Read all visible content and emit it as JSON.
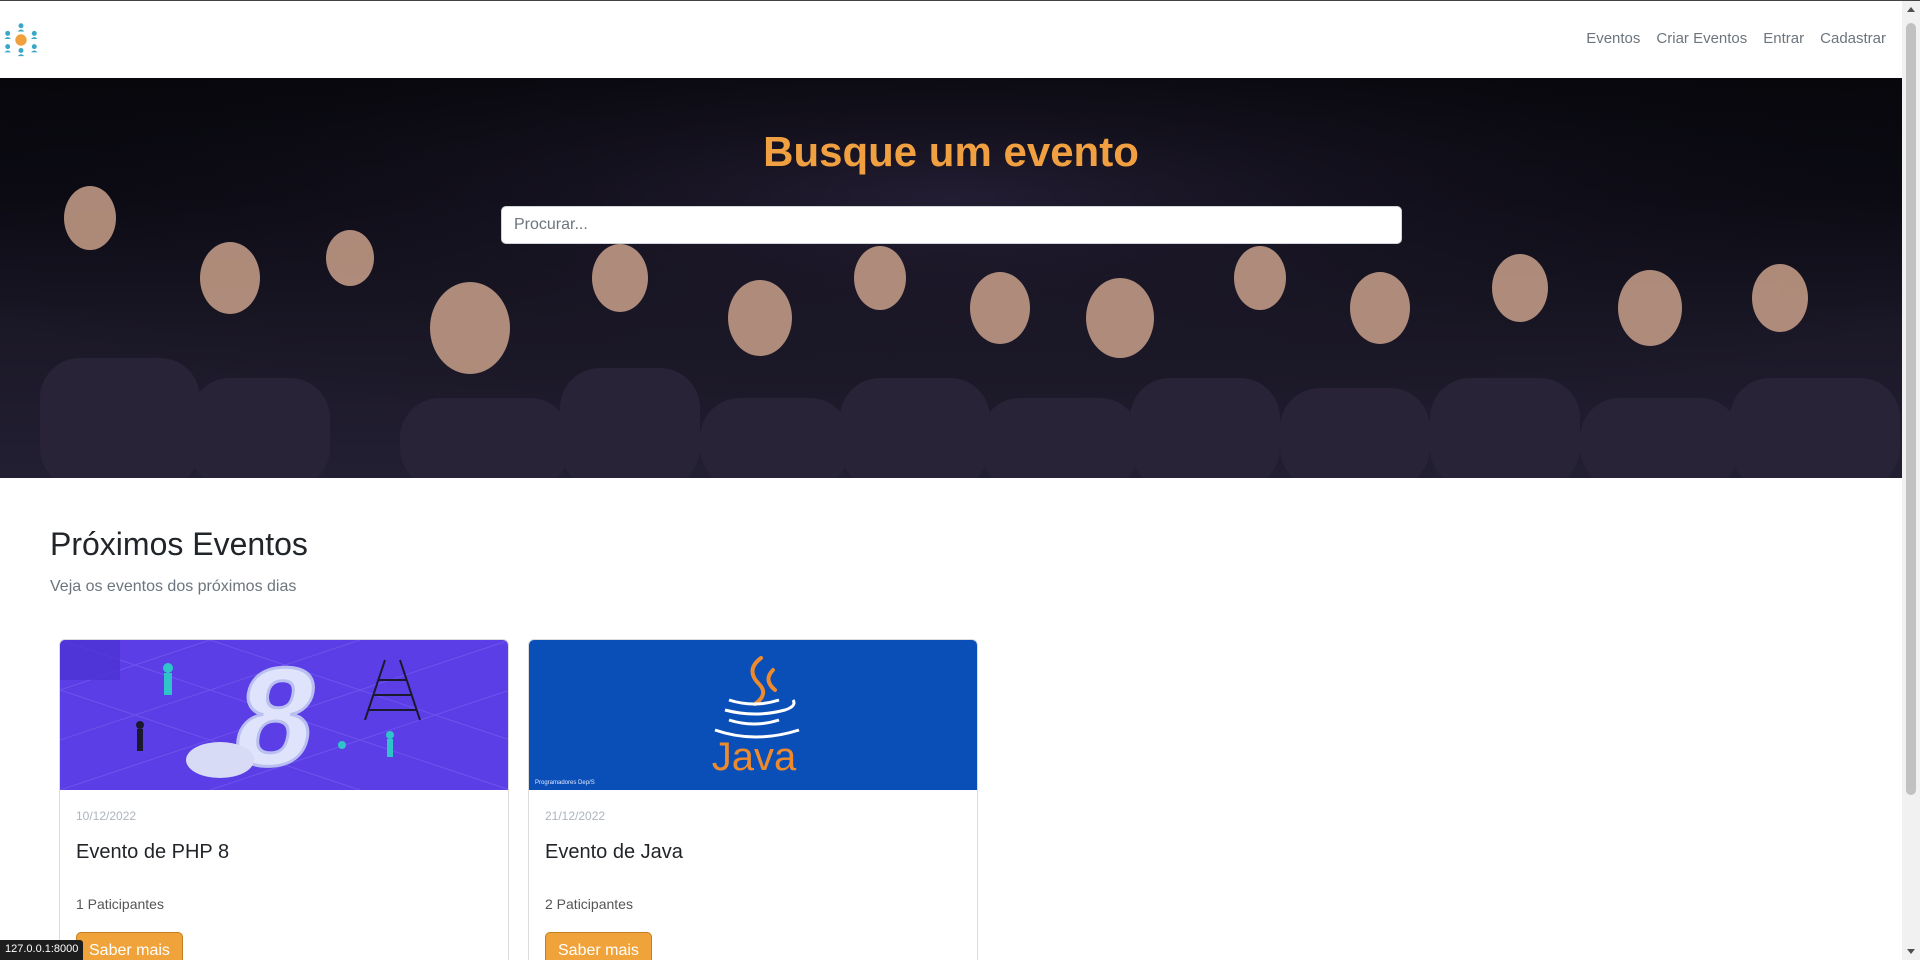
{
  "navbar": {
    "logo_icon": "people-network-icon",
    "links": [
      "Eventos",
      "Criar Eventos",
      "Entrar",
      "Cadastrar"
    ]
  },
  "hero": {
    "title": "Busque um evento",
    "search_placeholder": "Procurar...",
    "search_value": ""
  },
  "section": {
    "title": "Próximos Eventos",
    "subtitle": "Veja os eventos dos próximos dias"
  },
  "events": [
    {
      "date": "10/12/2022",
      "title": "Evento de PHP 8",
      "participants": "1 Paticipantes",
      "button": "Saber mais",
      "image_icon": "php8-illustration"
    },
    {
      "date": "21/12/2022",
      "title": "Evento de Java",
      "participants": "2 Paticipantes",
      "button": "Saber mais",
      "image_icon": "java-logo"
    }
  ],
  "java_banner_caption": "Programadores Dep/S",
  "status_url": "127.0.0.1:8000",
  "colors": {
    "accent": "#f0a33a",
    "hero_title": "#f0a040",
    "php_bg": "#5b3ee6",
    "java_bg": "#0a4fb8"
  }
}
